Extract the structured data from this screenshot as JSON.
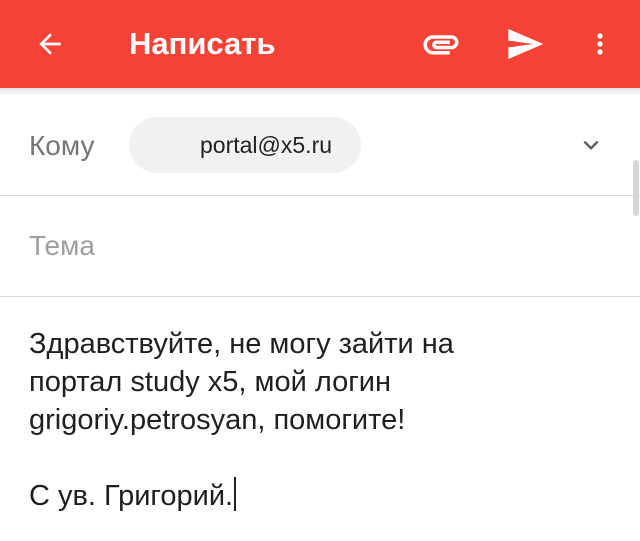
{
  "toolbar": {
    "title": "Написать",
    "background_color": "#f44336",
    "icons": {
      "back": "arrow-back-icon",
      "attach": "paperclip-icon",
      "send": "send-icon",
      "more": "more-vertical-icon"
    }
  },
  "compose": {
    "to_label": "Кому",
    "recipient": "portal@x5.ru",
    "subject_placeholder": "Тема",
    "subject_value": "",
    "body_lines": [
      "Здравствуйте, не могу зайти на",
      "портал study x5, мой логин",
      "grigoriy.petrosyan, помогите!",
      "",
      "С ув. Григорий."
    ]
  }
}
